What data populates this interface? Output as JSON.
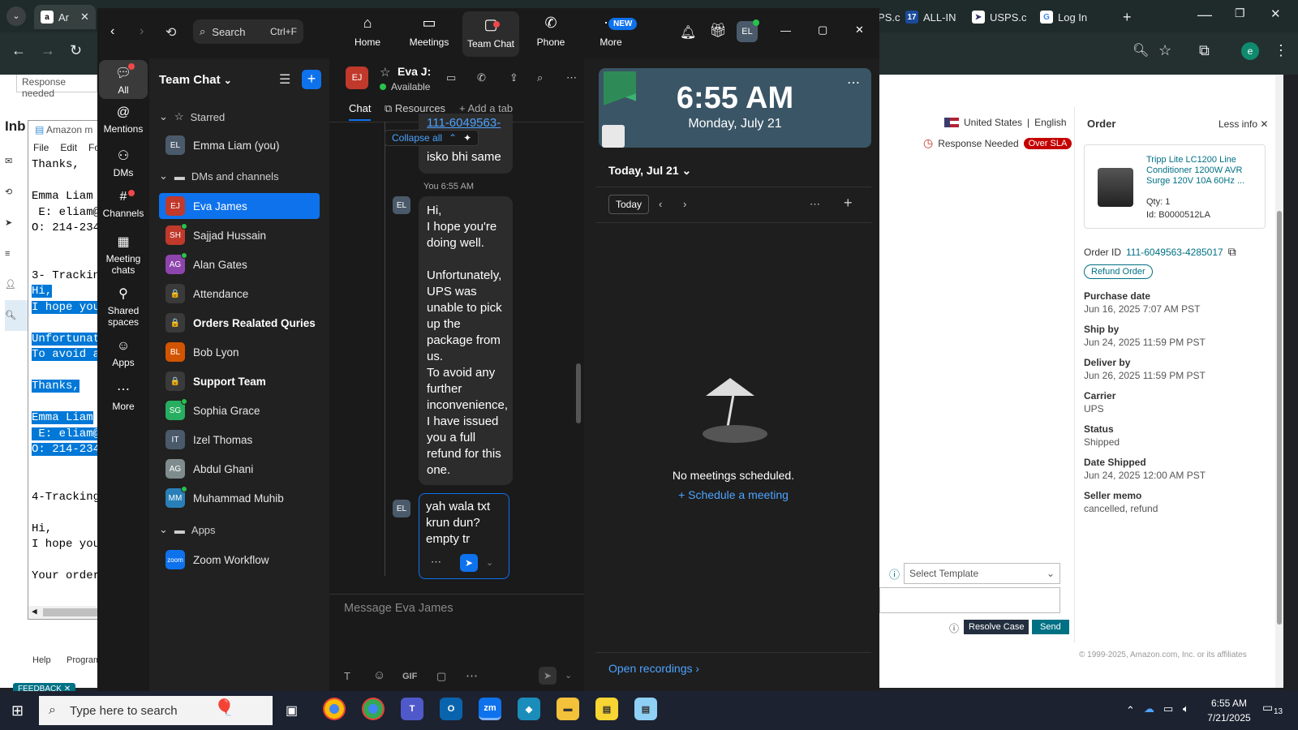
{
  "browser": {
    "tabs": [
      {
        "label": "Ar",
        "icon": "amazon-icon"
      },
      {
        "label": "USPS.c"
      },
      {
        "label": "ALL-IN"
      },
      {
        "label": "USPS.c"
      },
      {
        "label": "Log In"
      }
    ],
    "new_tab": "+",
    "profile_initial": "e"
  },
  "amazon": {
    "response_needed_top": "Response needed",
    "inbox_label": "Inb",
    "region": "United States",
    "language": "English",
    "response_needed": "Response Needed",
    "over_sla": "Over SLA",
    "select_template": "Select Template",
    "resolve_case": "Resolve Case",
    "send": "Send",
    "help": "Help",
    "program": "Program",
    "feedback": "FEEDBACK",
    "copyright": "© 1999-2025, Amazon.com, Inc. or its affiliates",
    "order": {
      "title": "Order",
      "less_info": "Less info",
      "product_name": "Tripp Lite LC1200 Line Conditioner 1200W AVR Surge 120V 10A 60Hz ...",
      "qty": "Qty: 1",
      "id": "Id: B0000512LA",
      "order_id_label": "Order ID",
      "order_id": "111-6049563-4285017",
      "refund_button": "Refund Order",
      "fields": [
        {
          "label": "Purchase date",
          "value": "Jun 16, 2025 7:07 AM PST"
        },
        {
          "label": "Ship by",
          "value": "Jun 24, 2025 11:59 PM PST"
        },
        {
          "label": "Deliver by",
          "value": "Jun 26, 2025 11:59 PM PST"
        },
        {
          "label": "Carrier",
          "value": "UPS"
        },
        {
          "label": "Status",
          "value": "Shipped"
        },
        {
          "label": "Date Shipped",
          "value": "Jun 24, 2025 12:00 AM PST"
        },
        {
          "label": "Seller memo",
          "value": "cancelled, refund"
        }
      ]
    }
  },
  "notepad": {
    "title": "Amazon m",
    "menu": [
      "File",
      "Edit",
      "Fo"
    ],
    "lines": [
      {
        "text": "Thanks,",
        "sel": false
      },
      {
        "text": "",
        "sel": false
      },
      {
        "text": "Emma Liam",
        "sel": false
      },
      {
        "text": " E: eliam@",
        "sel": false
      },
      {
        "text": "O: 214-234",
        "sel": false
      },
      {
        "text": "",
        "sel": false
      },
      {
        "text": "",
        "sel": false
      },
      {
        "text": "3- Trackin",
        "sel": false
      },
      {
        "text": "Hi,",
        "sel": true
      },
      {
        "text": "I hope you",
        "sel": true
      },
      {
        "text": "",
        "sel": false
      },
      {
        "text": "Unfortunat",
        "sel": true
      },
      {
        "text": "To avoid a",
        "sel": true
      },
      {
        "text": "",
        "sel": false
      },
      {
        "text": "Thanks,",
        "sel": true
      },
      {
        "text": "",
        "sel": false
      },
      {
        "text": "Emma Liam",
        "sel": true
      },
      {
        "text": " E: eliam@",
        "sel": true
      },
      {
        "text": "O: 214-234",
        "sel": true
      },
      {
        "text": "",
        "sel": false
      },
      {
        "text": "",
        "sel": false
      },
      {
        "text": "4-Tracking",
        "sel": false
      },
      {
        "text": "",
        "sel": false
      },
      {
        "text": "Hi,",
        "sel": false
      },
      {
        "text": "I hope you",
        "sel": false
      },
      {
        "text": "",
        "sel": false
      },
      {
        "text": "Your order",
        "sel": false
      }
    ]
  },
  "zoom": {
    "search_label": "Search",
    "search_shortcut": "Ctrl+F",
    "nav": [
      {
        "label": "Home",
        "icon": "home-icon"
      },
      {
        "label": "Meetings",
        "icon": "video-icon"
      },
      {
        "label": "Team Chat",
        "icon": "chat-icon"
      },
      {
        "label": "Phone",
        "icon": "phone-icon"
      },
      {
        "label": "More",
        "icon": "more-icon"
      }
    ],
    "new_badge": "NEW",
    "user_initials": "EL",
    "rail": [
      {
        "label": "All",
        "icon": "chat-bubble-icon"
      },
      {
        "label": "Mentions",
        "icon": "at-icon"
      },
      {
        "label": "DMs",
        "icon": "people-icon"
      },
      {
        "label": "Channels",
        "icon": "hash-icon"
      },
      {
        "label": "Meeting chats",
        "icon": "calendar-icon"
      },
      {
        "label": "Shared spaces",
        "icon": "share-icon"
      },
      {
        "label": "Apps",
        "icon": "apps-icon"
      },
      {
        "label": "More",
        "icon": "ellipsis-icon"
      }
    ],
    "list_title": "Team Chat",
    "starred_label": "Starred",
    "starred": [
      {
        "name": "Emma Liam (you)",
        "initials": "EL",
        "color": "#4a5a6a"
      }
    ],
    "dms_label": "DMs and channels",
    "dms": [
      {
        "name": "Eva James",
        "initials": "EJ",
        "color": "#c0392b",
        "online": false,
        "bold": false
      },
      {
        "name": "Sajjad Hussain",
        "initials": "SH",
        "color": "#c0392b",
        "online": true,
        "bold": false
      },
      {
        "name": "Alan Gates",
        "initials": "AG",
        "color": "#8e44ad",
        "online": true,
        "bold": false
      },
      {
        "name": "Attendance",
        "initials": "🔒",
        "color": "#3a3a3a",
        "online": false,
        "bold": false
      },
      {
        "name": "Orders Realated Quries",
        "initials": "🔒",
        "color": "#3a3a3a",
        "online": false,
        "bold": true
      },
      {
        "name": "Bob Lyon",
        "initials": "BL",
        "color": "#d35400",
        "online": false,
        "bold": false
      },
      {
        "name": "Support Team",
        "initials": "🔒",
        "color": "#3a3a3a",
        "online": false,
        "bold": true
      },
      {
        "name": "Sophia Grace",
        "initials": "SG",
        "color": "#27ae60",
        "online": true,
        "bold": false
      },
      {
        "name": "Izel Thomas",
        "initials": "IT",
        "color": "#4a5a6a",
        "online": false,
        "bold": false
      },
      {
        "name": "Abdul Ghani",
        "initials": "AG",
        "color": "#7f8c8d",
        "online": false,
        "bold": false
      },
      {
        "name": "Muhammad Muhib",
        "initials": "MM",
        "color": "#2980b9",
        "online": true,
        "bold": false
      }
    ],
    "apps_label": "Apps",
    "apps": [
      {
        "name": "Zoom Workflow",
        "initials": "zoom",
        "color": "#0e72ed"
      }
    ],
    "chat": {
      "contact_name": "Eva J:",
      "contact_initials": "EJ",
      "status": "Available",
      "tabs": [
        "Chat",
        "Resources",
        "Add a tab"
      ],
      "link_fragment": "111-6049563-",
      "collapse_all": "Collapse all",
      "prev_msg": "isko bhi same",
      "sender_time": "You 6:55 AM",
      "message": "Hi,\nI hope you're doing well.\n\nUnfortunately, UPS was unable to pick up the package from us.\nTo avoid any further inconvenience, I have issued you a full refund for this one.",
      "editing": "yah wala txt krun dun? empty tr",
      "composer_placeholder": "Message Eva James",
      "composer_tools": [
        "T",
        "☺",
        "GIF",
        "▢",
        "⋯"
      ]
    },
    "meetings": {
      "time": "6:55 AM",
      "date": "Monday, July 21",
      "today_header": "Today, Jul 21",
      "today_btn": "Today",
      "no_meetings": "No meetings scheduled.",
      "schedule": "Schedule a meeting",
      "open_recordings": "Open recordings"
    }
  },
  "taskbar": {
    "search_placeholder": "Type here to search",
    "time": "6:55 AM",
    "date": "7/21/2025",
    "notif_count": "13"
  }
}
